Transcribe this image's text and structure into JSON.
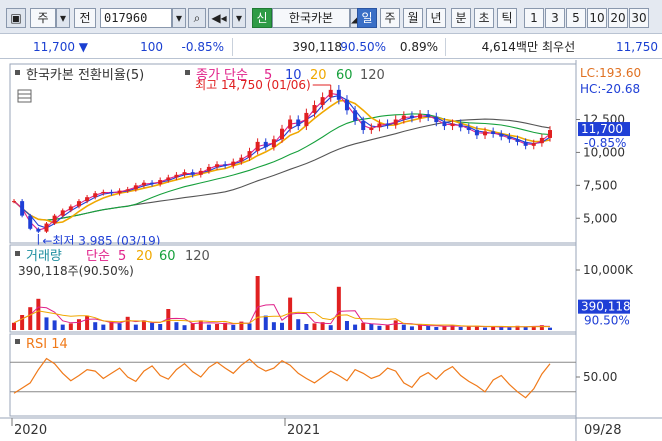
{
  "toolbar": {
    "market_label": "주",
    "type_label": "전",
    "stock_code": "017960",
    "new_badge": "신",
    "stock_name": "한국카본",
    "periods": [
      {
        "label": "일",
        "selected": true
      },
      {
        "label": "주",
        "selected": false
      },
      {
        "label": "월",
        "selected": false
      },
      {
        "label": "년",
        "selected": false
      },
      {
        "label": "분",
        "selected": false
      },
      {
        "label": "초",
        "selected": false
      },
      {
        "label": "틱",
        "selected": false
      }
    ],
    "intervals": [
      "1",
      "3",
      "5",
      "10",
      "20",
      "30"
    ]
  },
  "quote": {
    "price": "11,700",
    "change": "100",
    "change_pct": "-0.85%",
    "volume": "390,118",
    "volume_ratio": "90.50%",
    "turnover_pct": "0.89%",
    "amount": "4,614백만",
    "best_ask_label": "최우선",
    "best_ask": "11,750"
  },
  "price_panel": {
    "title": "한국카본 전환비율(5)",
    "ma_prefix": "종가 단순",
    "ma_periods": [
      "5",
      "10",
      "20",
      "60",
      "120"
    ],
    "ma_colors": [
      "#e0218a",
      "#1f3fd6",
      "#f0a800",
      "#16a03c",
      "#555555"
    ],
    "lc": "LC:193.60",
    "hc": "HC:-20.68",
    "high_annotation": "최고 14,750 (01/06)",
    "low_annotation": "최저 3,985 (03/19)",
    "axis_labels": [
      "12,500",
      "10,000",
      "7,500",
      "5,000"
    ],
    "current_price": "11,700",
    "current_pct": "-0.85%"
  },
  "volume_panel": {
    "title": "거래량",
    "ma_prefix": "단순",
    "ma_periods": [
      "5",
      "20",
      "60",
      "120"
    ],
    "ma_colors": [
      "#e0218a",
      "#f0a800",
      "#16a03c",
      "#555555"
    ],
    "summary": "390,118주(90.50%)",
    "axis_label": "10,000K",
    "current_volume": "390,118",
    "current_pct": "90.50%"
  },
  "rsi_panel": {
    "title": "RSI 14",
    "axis_label": "50.00"
  },
  "x_axis": {
    "labels": [
      "2020",
      "2021"
    ],
    "date": "09/28"
  },
  "chart_data": {
    "type": "line",
    "price_series": {
      "ylim": [
        3500,
        15500
      ],
      "values": [
        6300,
        5200,
        4200,
        3985,
        4600,
        5200,
        5600,
        5900,
        6300,
        6600,
        6900,
        7000,
        6900,
        7100,
        7200,
        7500,
        7700,
        7600,
        7900,
        8100,
        8300,
        8500,
        8300,
        8600,
        8900,
        9100,
        9000,
        9300,
        9600,
        10100,
        10800,
        10400,
        11000,
        11800,
        12500,
        12000,
        13000,
        13600,
        14200,
        14750,
        14000,
        13200,
        12400,
        11700,
        11900,
        12200,
        12100,
        12500,
        12800,
        12600,
        12900,
        12700,
        12300,
        12000,
        12200,
        11900,
        11700,
        11300,
        11600,
        11400,
        11200,
        11000,
        10800,
        10500,
        10700,
        11100,
        11700
      ]
    },
    "rsi_series": {
      "ylim": [
        0,
        100
      ],
      "reference_lines": [
        70,
        30
      ],
      "values": [
        28,
        35,
        42,
        60,
        75,
        68,
        55,
        45,
        52,
        60,
        58,
        48,
        55,
        62,
        50,
        44,
        58,
        65,
        52,
        47,
        60,
        68,
        57,
        50,
        63,
        70,
        62,
        55,
        66,
        74,
        64,
        58,
        62,
        72,
        66,
        55,
        48,
        42,
        50,
        58,
        52,
        45,
        60,
        55,
        48,
        52,
        62,
        58,
        42,
        36,
        50,
        56,
        47,
        58,
        64,
        52,
        44,
        38,
        30,
        46,
        52,
        40,
        30,
        22,
        34,
        54,
        68
      ]
    },
    "volume_series": {
      "ylim": [
        0,
        12000
      ],
      "values": [
        1200,
        2500,
        3800,
        5200,
        2100,
        1600,
        900,
        1100,
        1800,
        2400,
        1300,
        900,
        1500,
        1100,
        2200,
        900,
        1600,
        1200,
        1000,
        3500,
        1300,
        800,
        1100,
        1600,
        900,
        1000,
        1200,
        850,
        1400,
        1100,
        9000,
        2400,
        1300,
        1200,
        5400,
        1800,
        1000,
        1100,
        1300,
        800,
        7200,
        1500,
        900,
        1200,
        1000,
        700,
        800,
        1600,
        900,
        600,
        900,
        700,
        500,
        650,
        800,
        500,
        600,
        700,
        400,
        600,
        500,
        450,
        700,
        500,
        600,
        800,
        390
      ]
    }
  }
}
